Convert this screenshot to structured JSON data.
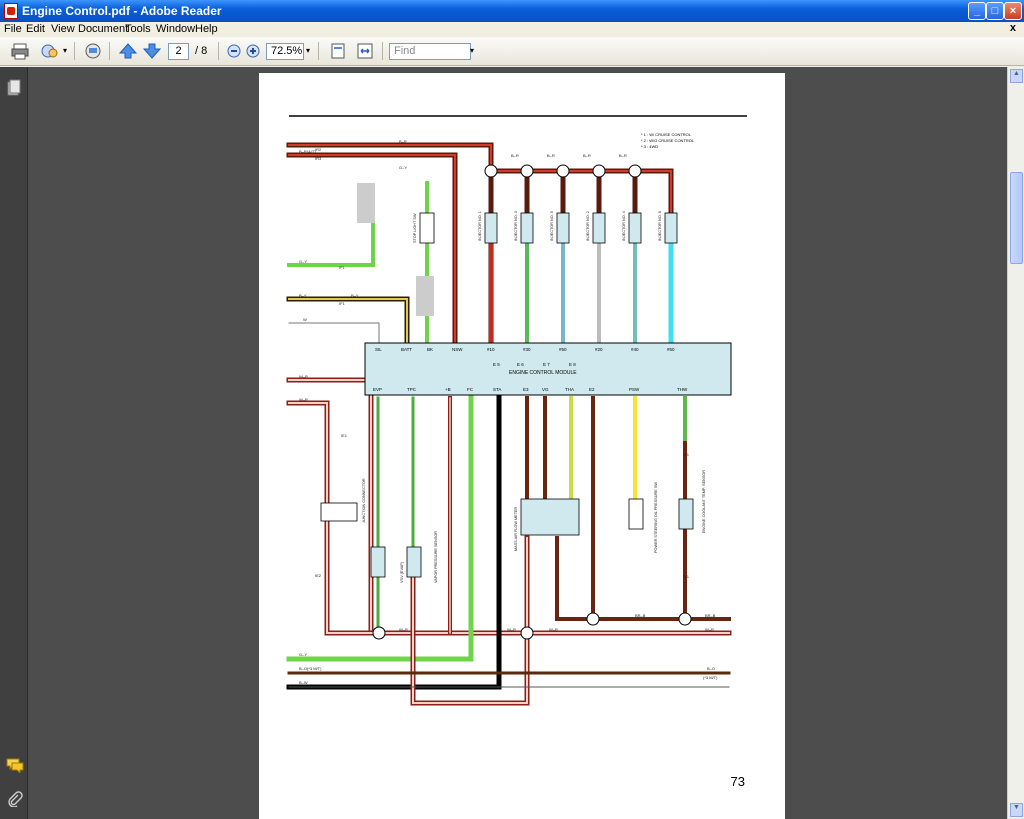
{
  "window": {
    "title": "Engine Control.pdf - Adobe Reader"
  },
  "menu": {
    "items": [
      "File",
      "Edit",
      "View",
      "Document",
      "Tools",
      "Window",
      "Help"
    ],
    "close": "x"
  },
  "toolbar": {
    "page_current": "2",
    "page_total": "/ 8",
    "zoom": "72.5%",
    "find_placeholder": "Find"
  },
  "document": {
    "page_number": "73",
    "notes": [
      "* 1 : W/ CRUISE CONTROL",
      "* 2 : W/O CRUISE CONTROL",
      "* 3 : 4WD"
    ],
    "module": {
      "name": "ENGINE CONTROL MODULE",
      "top_terminals": [
        "SIL",
        "BATT",
        "BK",
        "NSW",
        "#10",
        "#30",
        "#50",
        "#20",
        "#40",
        "#60"
      ],
      "top_pins": [
        "8",
        "14",
        "4",
        "14",
        "10",
        "11",
        "6",
        "9",
        "7",
        "5"
      ],
      "bottom_terminals": [
        "EVP",
        "TPC",
        "+B",
        "FC",
        "STA",
        "E3",
        "VG",
        "THA",
        "E2",
        "PSW",
        "THW"
      ],
      "bottom_pins": [
        "2",
        "6",
        "23",
        "16",
        "17",
        "7",
        "8",
        "21",
        "22",
        "31",
        "20"
      ],
      "mid": [
        "E 5",
        "E 6",
        "E 7",
        "E 8"
      ]
    },
    "components": [
      "INJECTOR NO. 1",
      "INJECTOR NO. 3",
      "INJECTOR NO. 5",
      "INJECTOR NO. 2",
      "INJECTOR NO. 4",
      "INJECTOR NO. 6",
      "STOP LIGHT SW",
      "JUNCTION CONNECTOR",
      "VSV (EVAP)",
      "VAPOR PRESSURE SENSOR",
      "MASS AIR FLOW METER",
      "POWER STEERING OIL PRESSURE SW",
      "ENGINE COOLANT TEMP. SENSOR"
    ],
    "wire_labels": {
      "br": "B–R",
      "bratt": "B–R(A/T)",
      "gy": "G–Y",
      "by": "B–Y",
      "w": "W",
      "wr": "W–R",
      "bo": "B–O",
      "bw": "B–W",
      "bo3": "B–O(*3 M/T)",
      "brb": "BR–B",
      "wg": "W–G",
      "grg": "GR–G",
      "yg": "Y–G",
      "y": "Y",
      "gr": "G–R",
      "bw2": "B–W",
      "brw": "BR–W",
      "grr": "GR–R",
      "wl": "W–L",
      "lr": "L–R",
      "l": "L",
      "rb": "R–B",
      "bo4": "(*3 M/T)"
    },
    "connectors": {
      "ir2": "IR2",
      "ir3": "IR3",
      "if1": "IF1",
      "ie1": "IE1",
      "ie2": "IE2",
      "p2": "P2",
      "v4": "V 4",
      "v5": "V 5",
      "m1": "M 1",
      "e1": "E 1",
      "p10": "P 10",
      "s16": "S 16",
      "j2": "J2",
      "i6": "I6",
      "i7": "I7",
      "i8": "I8",
      "i9": "I9",
      "i10": "I10",
      "i11": "I11"
    }
  }
}
